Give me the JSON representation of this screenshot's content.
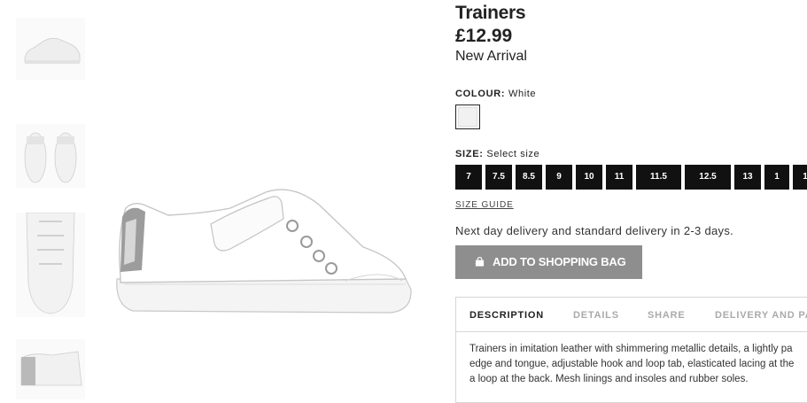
{
  "gallery": {
    "thumbnails": [
      "shoe-side-thumb",
      "shoe-pair-front-thumb",
      "shoe-top-laces-thumb",
      "shoe-heel-detail-thumb"
    ],
    "main_image": "shoe-side-view"
  },
  "product": {
    "title": "Trainers",
    "price": "£12.99",
    "tag": "New Arrival"
  },
  "colour": {
    "label": "COLOUR:",
    "value": "White",
    "swatch_color": "#f1f1f1"
  },
  "size": {
    "label": "SIZE:",
    "value": "Select size",
    "options": [
      "7",
      "7.5",
      "8.5",
      "9",
      "10",
      "11",
      "11.5",
      "12.5",
      "13",
      "1",
      "1"
    ],
    "guide_link": "SIZE GUIDE"
  },
  "delivery_text": "Next day delivery and standard delivery in 2-3 days.",
  "add_to_bag": {
    "label": "ADD TO SHOPPING BAG",
    "icon": "shopping-bag-icon",
    "color": "#8e8e8e"
  },
  "tabs": {
    "items": [
      "DESCRIPTION",
      "DETAILS",
      "SHARE",
      "DELIVERY AND PA"
    ],
    "active": "DESCRIPTION"
  },
  "description": {
    "lines": [
      "Trainers in imitation leather with shimmering metallic details, a lightly pa",
      "edge and tongue, adjustable hook and loop tab, elasticated lacing at the",
      "a loop at the back. Mesh linings and insoles and rubber soles."
    ]
  }
}
